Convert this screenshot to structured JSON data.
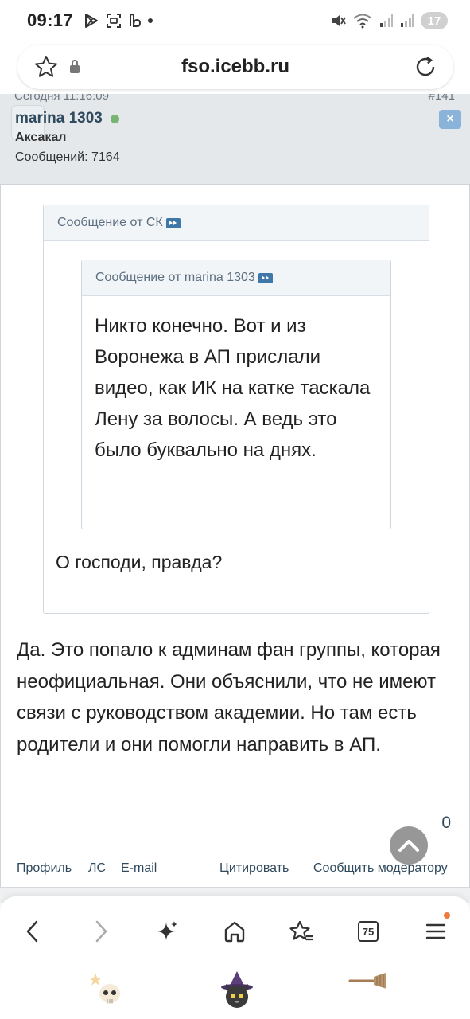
{
  "status_bar": {
    "time": "09:17",
    "battery": "17"
  },
  "url_bar": {
    "url": "fso.icebb.ru"
  },
  "post": {
    "date": "Сегодня 11:16:09",
    "number": "#141",
    "author": "marina 1303",
    "rank": "Аксакал",
    "message_count": "Сообщений: 7164",
    "close_label": "×",
    "outer_quote_header": "Сообщение от СК",
    "inner_quote_header": "Сообщение от marina 1303",
    "inner_quote_text": "Никто конечно. Вот и из Воронежа в АП прислали видео, как ИК на катке таскала Лену за волосы. А ведь это было буквально на днях.",
    "outer_quote_text": "О господи, правда?",
    "body_text": "Да. Это попало к админам фан группы, которая неофициальная. Они объяснили, что не имеют связи с руководством академии. Но там есть родители и они помогли направить в АП.",
    "like_count": "0",
    "links": {
      "profile": "Профиль",
      "pm": "ЛС",
      "email": "E-mail",
      "quote": "Цитировать",
      "report": "Сообщить модератору"
    }
  },
  "bottom_nav": {
    "tab_count": "75",
    "icons": [
      "back-icon",
      "forward-icon",
      "sparkle-icon",
      "home-icon",
      "bookmarks-icon",
      "tabs-icon",
      "menu-icon"
    ]
  },
  "colors": {
    "header_bg": "#e5e8eb",
    "link": "#2f4a5e",
    "online": "#76b672",
    "close_btn": "#8ab3da",
    "jump_icon": "#3f77a8",
    "notification_dot": "#f07a3e"
  }
}
